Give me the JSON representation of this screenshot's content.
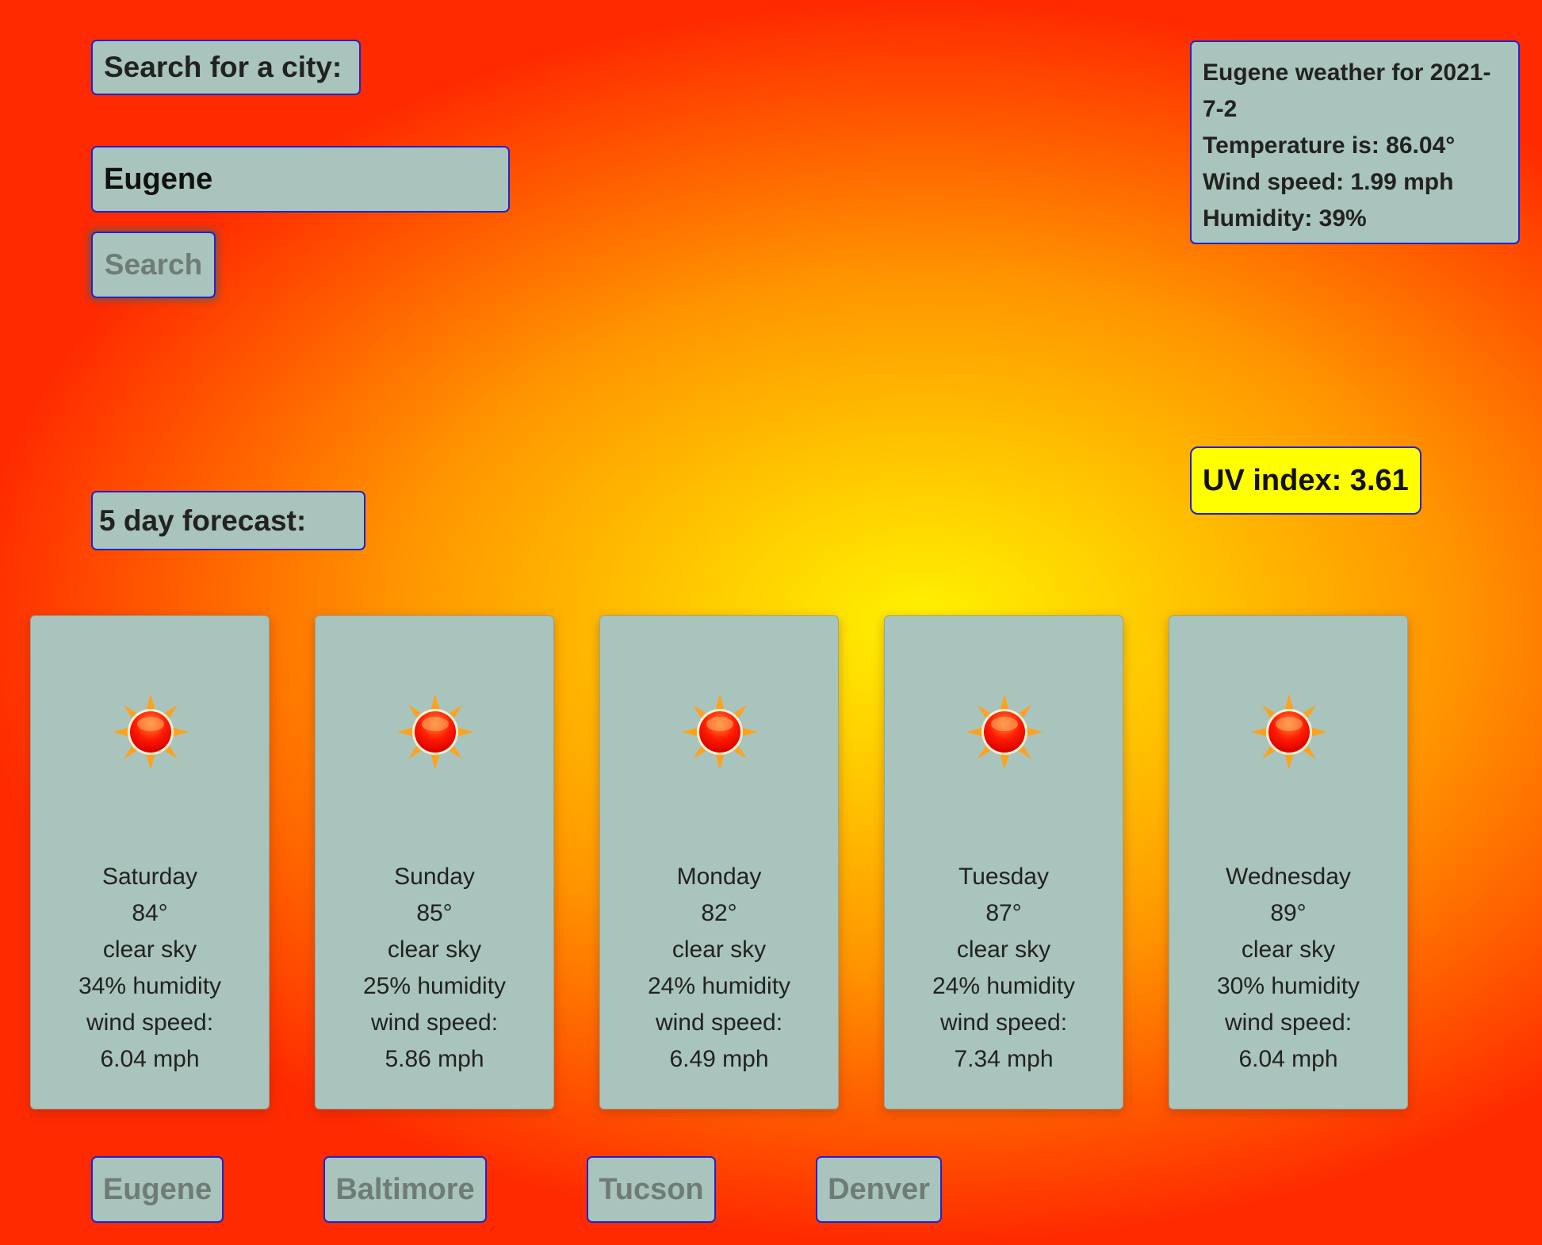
{
  "search": {
    "label": "Search for a city:",
    "input_value": "Eugene",
    "button_label": "Search"
  },
  "current": {
    "title": "Eugene weather for 2021-7-2",
    "temperature": "Temperature is: 86.04°",
    "wind": "Wind speed: 1.99 mph",
    "humidity": "Humidity: 39%",
    "uv": "UV index: 3.61"
  },
  "forecast": {
    "label": "5 day forecast:",
    "days": [
      {
        "day": "Saturday",
        "temp": "84°",
        "desc": "clear sky",
        "humidity": "34% humidity",
        "wind_label": "wind speed:",
        "wind": "6.04 mph",
        "icon": "sun-icon"
      },
      {
        "day": "Sunday",
        "temp": "85°",
        "desc": "clear sky",
        "humidity": "25% humidity",
        "wind_label": "wind speed:",
        "wind": "5.86 mph",
        "icon": "sun-icon"
      },
      {
        "day": "Monday",
        "temp": "82°",
        "desc": "clear sky",
        "humidity": "24% humidity",
        "wind_label": "wind speed:",
        "wind": "6.49 mph",
        "icon": "sun-icon"
      },
      {
        "day": "Tuesday",
        "temp": "87°",
        "desc": "clear sky",
        "humidity": "24% humidity",
        "wind_label": "wind speed:",
        "wind": "7.34 mph",
        "icon": "sun-icon"
      },
      {
        "day": "Wednesday",
        "temp": "89°",
        "desc": "clear sky",
        "humidity": "30% humidity",
        "wind_label": "wind speed:",
        "wind": "6.04 mph",
        "icon": "sun-icon"
      }
    ]
  },
  "history": {
    "cities": [
      "Eugene",
      "Baltimore",
      "Tucson",
      "Denver"
    ]
  },
  "colors": {
    "panel": "#a9c4bc",
    "border": "#2323c8",
    "uv_badge": "#ffff00"
  }
}
